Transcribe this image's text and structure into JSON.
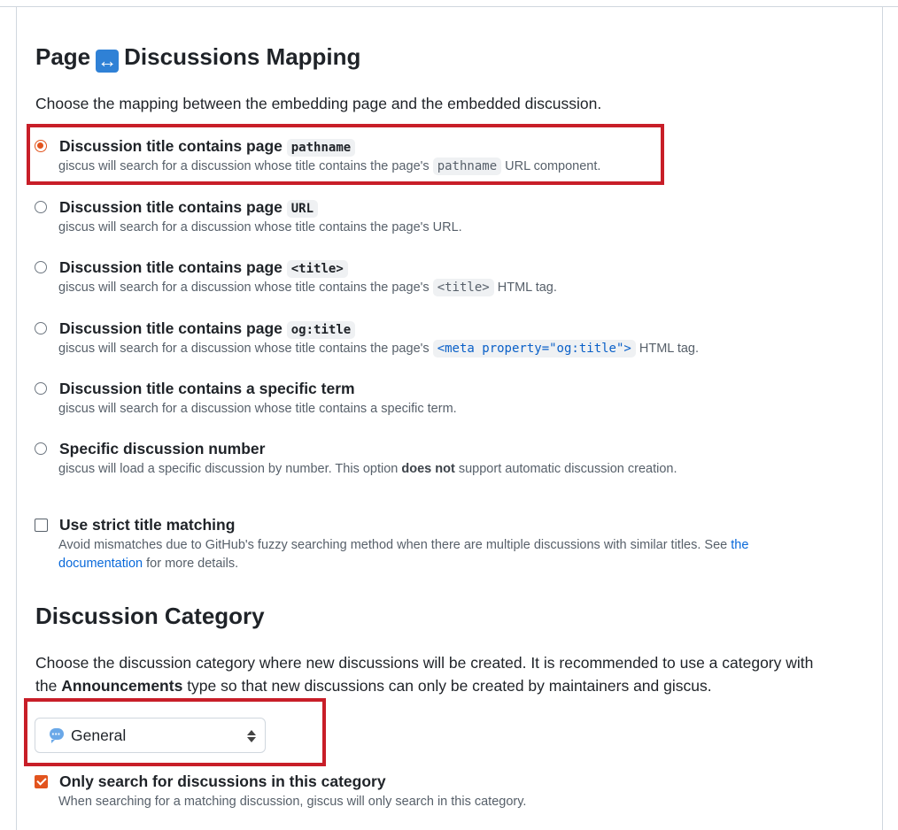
{
  "mapping": {
    "title_before": "Page",
    "title_after": "Discussions Mapping",
    "description": "Choose the mapping between the embedding page and the embedded discussion.",
    "options": [
      {
        "title": "Discussion title contains page",
        "code": "pathname",
        "desc_before": "giscus will search for a discussion whose title contains the page's",
        "desc_code": "pathname",
        "desc_after": "URL component."
      },
      {
        "title": "Discussion title contains page",
        "code": "URL",
        "desc": "giscus will search for a discussion whose title contains the page's URL."
      },
      {
        "title": "Discussion title contains page",
        "code": "<title>",
        "desc_before": "giscus will search for a discussion whose title contains the page's",
        "desc_code": "<title>",
        "desc_after": "HTML tag."
      },
      {
        "title": "Discussion title contains page",
        "code": "og:title",
        "desc_before": "giscus will search for a discussion whose title contains the page's",
        "desc_code": "<meta property=\"og:title\">",
        "desc_after": "HTML tag."
      },
      {
        "title": "Discussion title contains a specific term",
        "desc": "giscus will search for a discussion whose title contains a specific term."
      },
      {
        "title": "Specific discussion number",
        "desc_before": "giscus will load a specific discussion by number. This option",
        "desc_bold": "does not",
        "desc_after": "support automatic discussion creation."
      }
    ],
    "selected_index": 0,
    "strict": {
      "title": "Use strict title matching",
      "desc_before": "Avoid mismatches due to GitHub's fuzzy searching method when there are multiple discussions with similar titles. See",
      "link_1": "the",
      "link_2": "documentation",
      "desc_after": "for more details.",
      "checked": false
    }
  },
  "category": {
    "title": "Discussion Category",
    "desc_before": "Choose the discussion category where new discussions will be created. It is recommended to use a category with",
    "desc_line2_before": "the",
    "desc_bold": "Announcements",
    "desc_after": "type so that new discussions can only be created by maintainers and giscus.",
    "select_value": "General",
    "select_icon": "speech-bubble-icon",
    "only_search": {
      "title": "Only search for discussions in this category",
      "desc": "When searching for a matching discussion, giscus will only search in this category.",
      "checked": true
    }
  },
  "colors": {
    "accent": "#e2541e",
    "highlight_box": "#c81e28",
    "link": "#0969da"
  }
}
